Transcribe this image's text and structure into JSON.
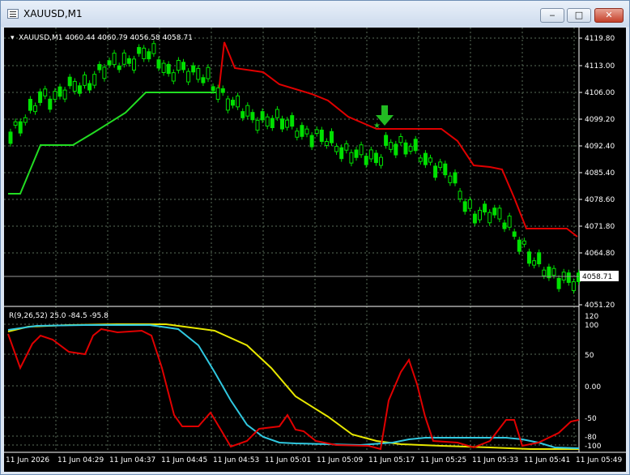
{
  "window": {
    "title": "XAUUSD,M1",
    "minimize_label": "‒",
    "maximize_label": "□",
    "close_label": "✕"
  },
  "chart": {
    "header": "XAUUSD,M1  4060.44 4060.79 4056.58 4058.71",
    "price_labels": [
      "4119.80",
      "4113.00",
      "4106.00",
      "4099.20",
      "4092.40",
      "4085.40",
      "4078.60",
      "4071.80",
      "4064.80",
      "4051.20"
    ],
    "current_price": "4058.71",
    "indicator_header": "R(9,26,52) 25.0 -84.5 -95.8",
    "indicator_labels": [
      "120",
      "100",
      "50",
      "0.00",
      "-50",
      "-80",
      "-100"
    ],
    "time_labels": [
      "11 Jun 2026",
      "11 Jun 04:29",
      "11 Jun 04:37",
      "11 Jun 04:45",
      "11 Jun 04:53",
      "11 Jun 05:01",
      "11 Jun 05:09",
      "11 Jun 05:17",
      "11 Jun 05:25",
      "11 Jun 05:33",
      "11 Jun 05:41",
      "11 Jun 05:49"
    ],
    "colors": {
      "background": "#000000",
      "grid": "#5a6e5a",
      "candle": "#00e000",
      "stop_up": "#22dd22",
      "stop_down": "#e00000",
      "signal_arrow": "#22bb22",
      "ind_red": "#e00000",
      "ind_cyan": "#30c8e0",
      "ind_yellow": "#e8e800"
    }
  }
}
